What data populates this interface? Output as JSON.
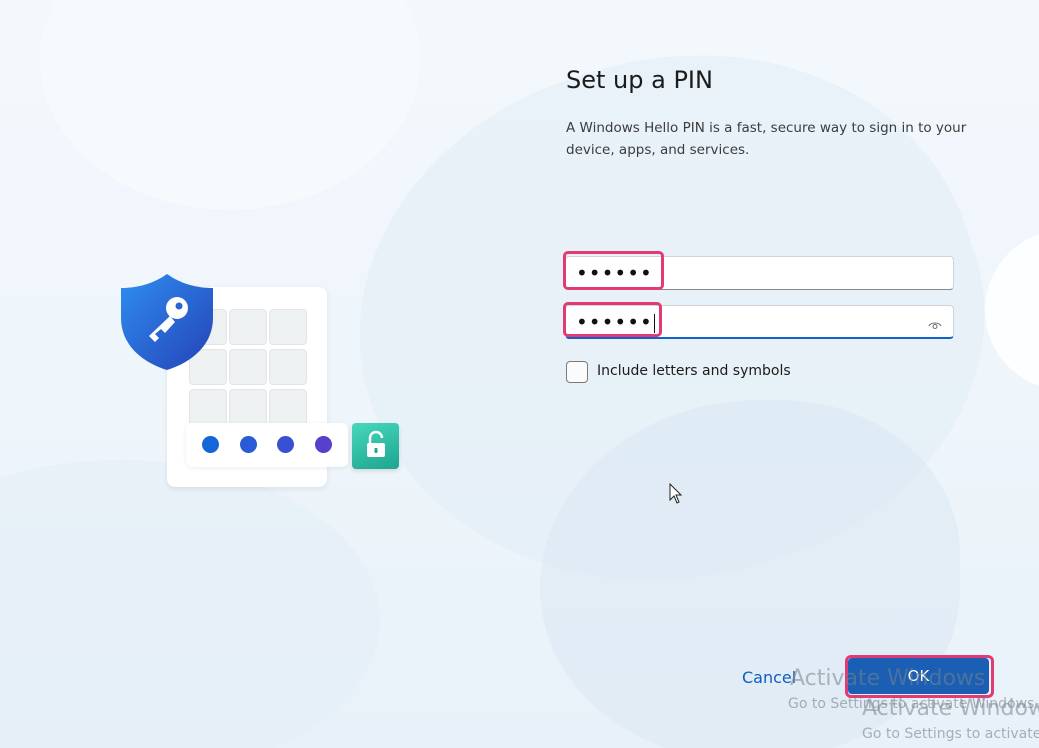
{
  "page": {
    "title": "Set up a PIN",
    "description": "A Windows Hello PIN is a fast, secure way to sign in to your device, apps, and services."
  },
  "pin_fields": {
    "new_pin_value": "••••••",
    "confirm_pin_value": "••••••"
  },
  "checkbox": {
    "label": "Include letters and symbols",
    "checked": false
  },
  "buttons": {
    "cancel": "Cancel",
    "ok": "OK"
  },
  "watermark": {
    "line1": "Activate Windows",
    "line2": "Go to Settings to activate Windows."
  },
  "colors": {
    "accent": "#1a5fb4",
    "highlight": "#e23b74",
    "shield": "#2b6bd8",
    "unlock": "#2bc3a8"
  },
  "icons": [
    "shield-key-icon",
    "unlock-icon",
    "eye-icon",
    "mouse-cursor-icon"
  ]
}
